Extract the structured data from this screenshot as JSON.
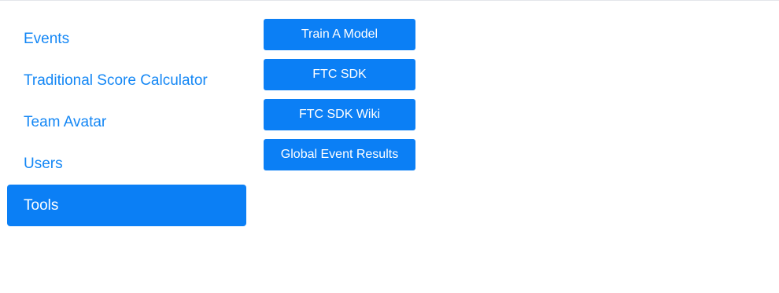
{
  "nav": {
    "items": [
      {
        "label": "Events",
        "active": false
      },
      {
        "label": "Traditional Score Calculator",
        "active": false
      },
      {
        "label": "Team Avatar",
        "active": false
      },
      {
        "label": "Users",
        "active": false
      },
      {
        "label": "Tools",
        "active": true
      }
    ]
  },
  "tools": {
    "buttons": [
      {
        "label": "Train A Model"
      },
      {
        "label": "FTC SDK"
      },
      {
        "label": "FTC SDK Wiki"
      },
      {
        "label": "Global Event Results"
      }
    ]
  },
  "colors": {
    "accent": "#0b7ff5",
    "link": "#1487f5",
    "divider": "#e3e6ea"
  }
}
